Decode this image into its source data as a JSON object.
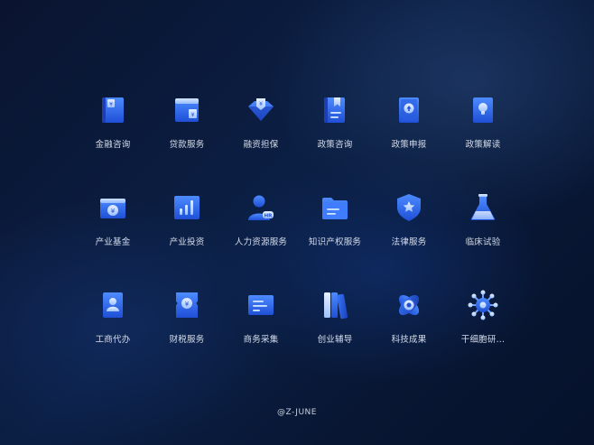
{
  "icons": [
    {
      "label": "金融咨询",
      "icon": "finance-consult-icon"
    },
    {
      "label": "贷款服务",
      "icon": "loan-service-icon"
    },
    {
      "label": "融资担保",
      "icon": "financing-guarantee-icon"
    },
    {
      "label": "政策咨询",
      "icon": "policy-consult-icon"
    },
    {
      "label": "政策申报",
      "icon": "policy-declare-icon"
    },
    {
      "label": "政策解读",
      "icon": "policy-interpret-icon"
    },
    {
      "label": "产业基金",
      "icon": "industry-fund-icon"
    },
    {
      "label": "产业投资",
      "icon": "industry-investment-icon"
    },
    {
      "label": "人力资源服务",
      "icon": "hr-service-icon"
    },
    {
      "label": "知识产权服务",
      "icon": "ip-service-icon"
    },
    {
      "label": "法律服务",
      "icon": "legal-service-icon"
    },
    {
      "label": "临床试验",
      "icon": "clinical-trial-icon"
    },
    {
      "label": "工商代办",
      "icon": "business-agency-icon"
    },
    {
      "label": "财税服务",
      "icon": "tax-service-icon"
    },
    {
      "label": "商务采集",
      "icon": "business-collection-icon"
    },
    {
      "label": "创业辅导",
      "icon": "startup-mentoring-icon"
    },
    {
      "label": "科技成果",
      "icon": "tech-achievement-icon"
    },
    {
      "label": "干细胞研...",
      "icon": "stem-cell-research-icon"
    }
  ],
  "footer": "@Z-JUNE",
  "colors": {
    "accent": "#2f6cf2",
    "light": "#8fb8ff",
    "label": "#d6ddea"
  }
}
